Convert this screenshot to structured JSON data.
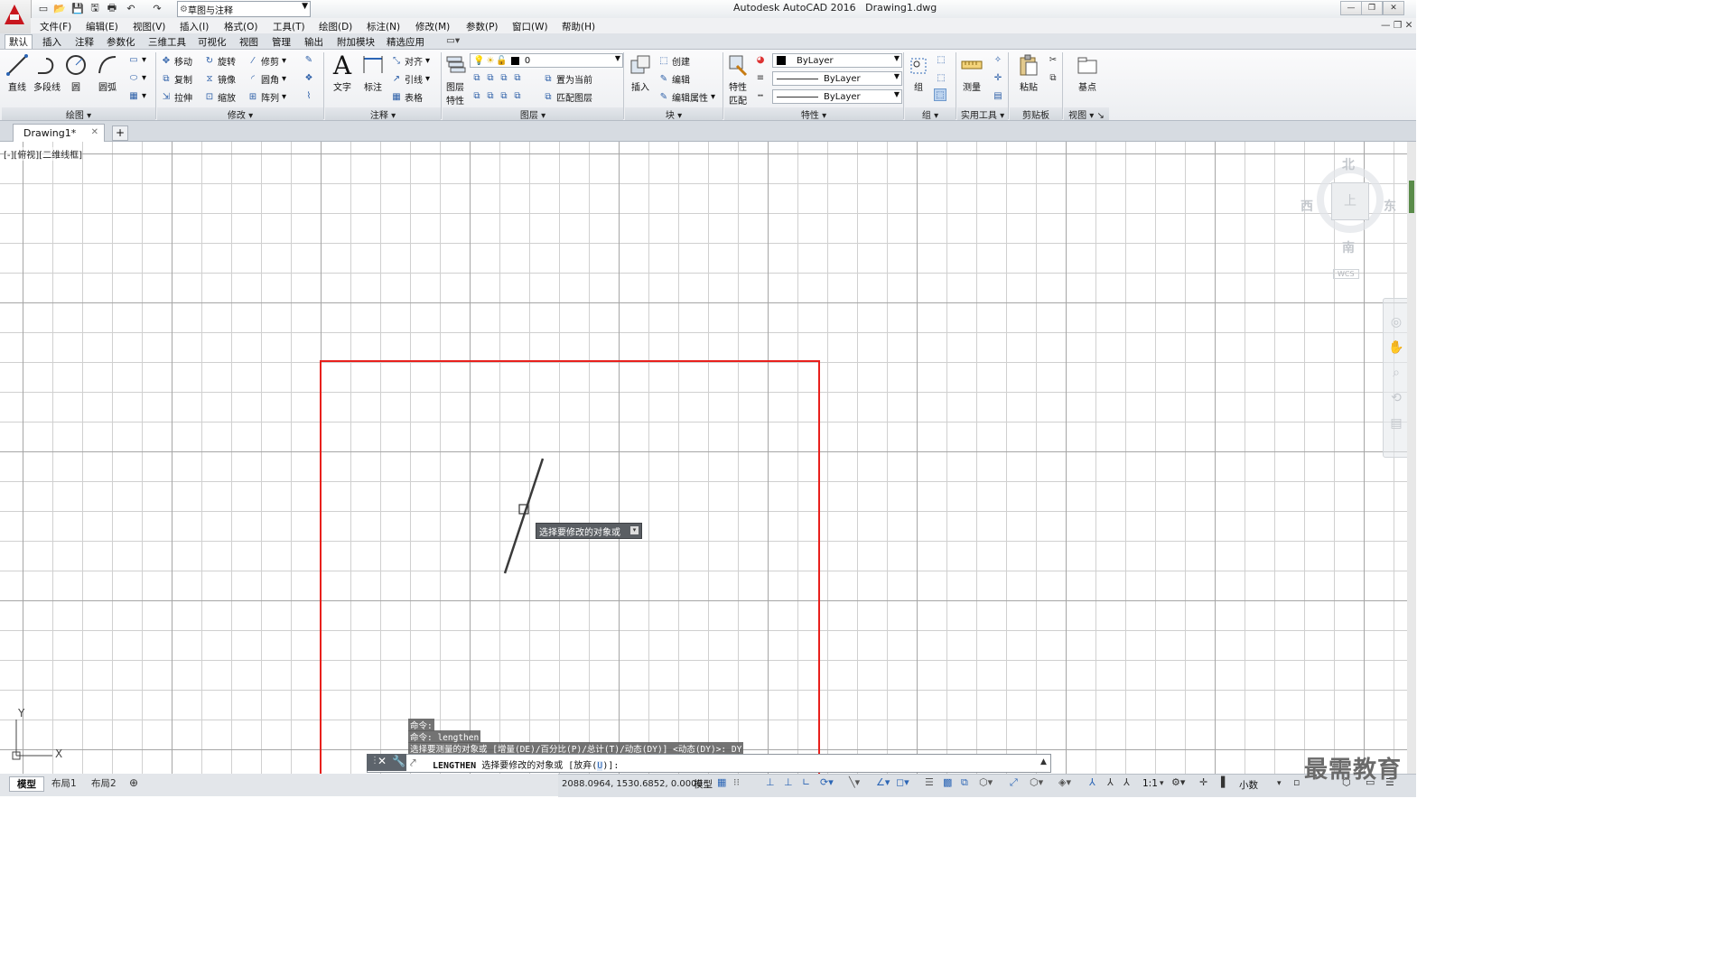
{
  "window": {
    "app_title": "Autodesk AutoCAD 2016",
    "file_name": "Drawing1.dwg",
    "workspace": "草图与注释"
  },
  "menubar": [
    "文件(F)",
    "编辑(E)",
    "视图(V)",
    "插入(I)",
    "格式(O)",
    "工具(T)",
    "绘图(D)",
    "标注(N)",
    "修改(M)",
    "参数(P)",
    "窗口(W)",
    "帮助(H)"
  ],
  "ribbon_tabs": [
    "默认",
    "插入",
    "注释",
    "参数化",
    "三维工具",
    "可视化",
    "视图",
    "管理",
    "输出",
    "附加模块",
    "精选应用"
  ],
  "ribbon": {
    "draw": {
      "title": "绘图",
      "line": "直线",
      "polyline": "多段线",
      "circle": "圆",
      "arc": "圆弧"
    },
    "modify": {
      "title": "修改",
      "move": "移动",
      "rotate": "旋转",
      "trim": "修剪",
      "copy": "复制",
      "mirror": "镜像",
      "fillet": "圆角",
      "stretch": "拉伸",
      "scale": "缩放",
      "array": "阵列"
    },
    "annotation": {
      "title": "注释",
      "text": "文字",
      "dimension": "标注",
      "align": "对齐",
      "leader": "引线",
      "table": "表格"
    },
    "layers": {
      "title": "图层",
      "layer_props": "图层",
      "layer_props2": "特性",
      "current_layer": "0",
      "set_current": "置为当前",
      "match_layer": "匹配图层"
    },
    "block": {
      "title": "块",
      "insert": "插入",
      "create": "创建",
      "edit": "编辑",
      "edit_attr": "编辑属性"
    },
    "properties": {
      "title": "特性",
      "match": "特性",
      "match2": "匹配",
      "color": "ByLayer",
      "linetype": "ByLayer",
      "lineweight": "ByLayer"
    },
    "groups": {
      "title": "组",
      "group": "组"
    },
    "utilities": {
      "title": "实用工具",
      "measure": "测量"
    },
    "clipboard": {
      "title": "剪贴板",
      "paste": "粘贴"
    },
    "view": {
      "title": "视图",
      "base": "基点"
    }
  },
  "doc_tab": {
    "label": "Drawing1*"
  },
  "viewport_label": "[-][俯视][二维线框]",
  "viewcube": {
    "north": "北",
    "south": "南",
    "east": "东",
    "west": "西",
    "top": "上",
    "wcs": "WCS"
  },
  "command": {
    "history": [
      "命令:",
      "命令:  lengthen",
      "选择要测量的对象或 [增量(DE)/百分比(P)/总计(T)/动态(DY)] <动态(DY)>: DY"
    ],
    "current_cmd": "LENGTHEN",
    "prompt": "选择要修改的对象或",
    "option_open": "[放弃(",
    "option_key": "U",
    "option_close": ")]:"
  },
  "tooltip": "选择要修改的对象或",
  "layout_tabs": [
    "模型",
    "布局1",
    "布局2"
  ],
  "status": {
    "coords": "2088.0964, 1530.6852, 0.0000",
    "mode": "模型",
    "scale": "1:1",
    "units": "小数"
  },
  "watermark": "最需教育",
  "colors": {
    "highlight": "#e8201c",
    "grid_major": "#a6a6a6",
    "grid_minor": "#d0d0d0",
    "accent": "#2b65b5"
  }
}
